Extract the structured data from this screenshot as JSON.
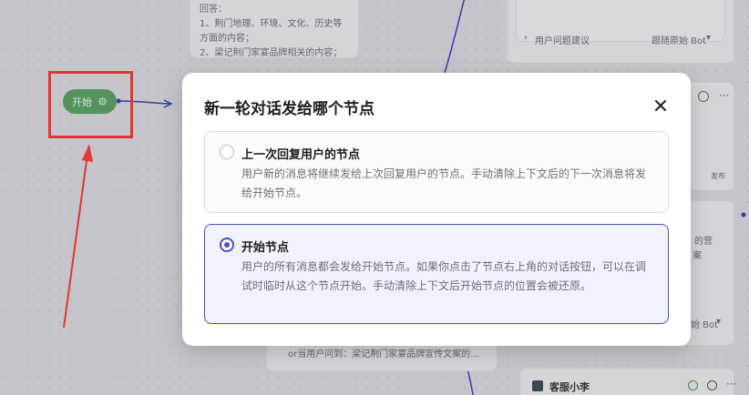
{
  "background": {
    "top_card_lines": [
      "回答：",
      "1、荆门地理、环境、文化、历史等方面的内容；",
      "2、梁记荆门家宴品牌相关的内容；"
    ],
    "start_node_label": "开始",
    "right_top": {
      "label": "用户问题建议",
      "value": "跟随原始 Bot",
      "chevron": "▾"
    },
    "right_mid": {
      "text_line1": "的营",
      "text_line2": "案",
      "date_fragment": "发布"
    },
    "right_lower": {
      "value": "始 Bot",
      "chevron": "▾"
    },
    "bottom_text": "or当用户问到：梁记荆门家宴品牌宣传文案的...",
    "bottom_card": {
      "title": "客服小李"
    }
  },
  "modal": {
    "title": "新一轮对话发给哪个节点",
    "options": [
      {
        "title": "上一次回复用户的节点",
        "description": "用户新的消息将继续发给上次回复用户的节点。手动清除上下文后的下一次消息将发给开始节点。",
        "selected": false
      },
      {
        "title": "开始节点",
        "description": "用户的所有消息都会发给开始节点。如果你点击了节点右上角的对话按钮，可以在调试时临时从这个节点开始。手动清除上下文后开始节点的位置会被还原。",
        "selected": true
      }
    ]
  },
  "colors": {
    "accent": "#4b4fc7",
    "highlight_frame": "#ee3b30",
    "start_node": "#5a9d62"
  }
}
